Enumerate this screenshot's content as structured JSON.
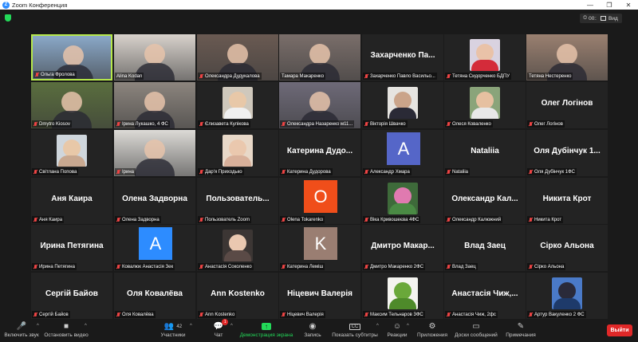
{
  "window": {
    "title": "Zoom Конференция",
    "logo": "Z",
    "minimize": "—",
    "maximize": "❐",
    "close": "✕"
  },
  "header": {
    "timer": "00:18:54",
    "timer_icon": "⏲",
    "view_label": "Вид"
  },
  "colors": {
    "active_border": "#b6e84b",
    "leave": "#e02828",
    "security": "#23d959"
  },
  "tiles": [
    {
      "caption": "Ольга Фролова",
      "kind": "video",
      "muted": true,
      "bg": "#8aa8c8",
      "active": true
    },
    {
      "caption": "Alina Kodan",
      "kind": "video",
      "muted": false,
      "bg": "#d8d2cc"
    },
    {
      "caption": "Олександра Дудукалова",
      "kind": "video",
      "muted": true,
      "bg": "#6a5a52"
    },
    {
      "caption": "Тамара Макаренко",
      "kind": "video",
      "muted": false,
      "bg": "#7a6e6a"
    },
    {
      "caption": "Захарченко Павло Васильо...",
      "kind": "name",
      "name": "Захарченко Па...",
      "muted": true
    },
    {
      "caption": "Тетяна Сидорченко БДПУ",
      "kind": "photo",
      "muted": true,
      "ph_bg": "#d9d2e0",
      "ph_head": "#e9c2a8",
      "ph_body": "#d42b3a"
    },
    {
      "caption": "Тетяна Нестеренко",
      "kind": "video",
      "muted": false,
      "bg": "#9a8070"
    },
    {
      "caption": "Dmytro Kiosov",
      "kind": "video",
      "muted": true,
      "bg": "#5a6e3e"
    },
    {
      "caption": "Ірина Лукашко, 4 ФС",
      "kind": "video",
      "muted": true,
      "bg": "#8c857e"
    },
    {
      "caption": "Єлизавета Кулікова",
      "kind": "photo",
      "muted": true,
      "ph_bg": "#cfc8bc",
      "ph_head": "#e8c8a8",
      "ph_body": "#f0f0f0"
    },
    {
      "caption": "Олександра Назаренко м11...",
      "kind": "video",
      "muted": true,
      "bg": "#6e6a78"
    },
    {
      "caption": "Вікторія Швачко",
      "kind": "photo",
      "muted": true,
      "ph_bg": "#e6e4e0",
      "ph_head": "#caa48a",
      "ph_body": "#2a2a36"
    },
    {
      "caption": "Олеся Коваленко",
      "kind": "photo",
      "muted": true,
      "ph_bg": "#8aa47a",
      "ph_head": "#e6c0a0",
      "ph_body": "#e8e8e8"
    },
    {
      "caption": "Олег Логінов",
      "kind": "name",
      "name": "Олег Логінов",
      "muted": true
    },
    {
      "caption": "Світлана Попова",
      "kind": "photo",
      "muted": true,
      "ph_bg": "#cfd6dc",
      "ph_head": "#e8c8a8",
      "ph_body": "#c8a890"
    },
    {
      "caption": "Ірина",
      "kind": "video",
      "muted": true,
      "bg": "#dcdad6"
    },
    {
      "caption": "Дар'я Приходько",
      "kind": "photo",
      "muted": true,
      "ph_bg": "#e8d8c8",
      "ph_head": "#eac8ae",
      "ph_body": "#d8b09a"
    },
    {
      "caption": "Катерина Дудорова",
      "kind": "name",
      "name": "Катерина Дудо...",
      "muted": true
    },
    {
      "caption": "Александр Хмара",
      "kind": "avatar",
      "letter": "A",
      "color": "#5566c8",
      "muted": true
    },
    {
      "caption": "Nataliia",
      "kind": "name",
      "name": "Nataliia",
      "muted": true
    },
    {
      "caption": "Оля Дубінчук 1ФС",
      "kind": "name",
      "name": "Оля Дубінчук 1...",
      "muted": true
    },
    {
      "caption": "Аня Каира",
      "kind": "name",
      "name": "Аня Каира",
      "muted": true
    },
    {
      "caption": "Олена Задворна",
      "kind": "name",
      "name": "Олена Задворна",
      "muted": true
    },
    {
      "caption": "Пользователь Zoom",
      "kind": "name",
      "name": "Пользователь...",
      "muted": true
    },
    {
      "caption": "Olena Tokarenko",
      "kind": "avatar",
      "letter": "O",
      "color": "#f04e1a",
      "muted": true
    },
    {
      "caption": "Віка Кривошеєва 4ФС",
      "kind": "photo",
      "muted": true,
      "ph_bg": "#3e6a3a",
      "ph_head": "#e07ab0",
      "ph_body": "#4a8a44"
    },
    {
      "caption": "Олександр Калюжний",
      "kind": "name",
      "name": "Олександр Кал...",
      "muted": true
    },
    {
      "caption": "Никита Крот",
      "kind": "name",
      "name": "Никита Крот",
      "muted": true
    },
    {
      "caption": "Ирина Петягина",
      "kind": "name",
      "name": "Ирина Петягина",
      "muted": true
    },
    {
      "caption": "Ковалюк Анастасія Зек",
      "kind": "avatar",
      "letter": "A",
      "color": "#2d8cff",
      "muted": true
    },
    {
      "caption": "Анастасія Соколенко",
      "kind": "photo",
      "muted": true,
      "ph_bg": "#3c3634",
      "ph_head": "#eac8b0",
      "ph_body": "#5a4a46"
    },
    {
      "caption": "Катерина Леміш",
      "kind": "avatar",
      "letter": "K",
      "color": "#9a7e72",
      "muted": true
    },
    {
      "caption": "Дмитро Макаренко 2ФС",
      "kind": "name",
      "name": "Дмитро Макар...",
      "muted": true
    },
    {
      "caption": "Влад Заец",
      "kind": "name",
      "name": "Влад Заец",
      "muted": true
    },
    {
      "caption": "Сірко Альона",
      "kind": "name",
      "name": "Сірко Альона",
      "muted": true
    },
    {
      "caption": "Сергій Байов",
      "kind": "name",
      "name": "Сергій Байов",
      "muted": true
    },
    {
      "caption": "Оля Ковалёва",
      "kind": "name",
      "name": "Оля Ковалёва",
      "muted": true
    },
    {
      "caption": "Ann Kostenko",
      "kind": "name",
      "name": "Ann Kostenko",
      "muted": true
    },
    {
      "caption": "Ніцевич Валерія",
      "kind": "name",
      "name": "Ніцевич Валерія",
      "muted": true
    },
    {
      "caption": "Максим Тельнаров 3ФС",
      "kind": "photo",
      "muted": true,
      "ph_bg": "#f4f4f0",
      "ph_head": "#6aa83a",
      "ph_body": "#4e8a2a"
    },
    {
      "caption": "Анастасія Чиж, 2фс",
      "kind": "name",
      "name": "Анастасія Чиж,...",
      "muted": true
    },
    {
      "caption": "Артур Вакуленко 2 ФС",
      "kind": "photo",
      "muted": true,
      "ph_bg": "#4a7ac8",
      "ph_head": "#2a2a3a",
      "ph_body": "#1e3a6a"
    }
  ],
  "toolbar": {
    "mic": {
      "icon": "🎤",
      "label": "Включить звук"
    },
    "video": {
      "icon": "■",
      "label": "Остановить видео"
    },
    "participants": {
      "icon": "👥",
      "label": "Участники",
      "count": "42"
    },
    "chat": {
      "icon": "💬",
      "label": "Чат",
      "badge": "1"
    },
    "share": {
      "icon": "↑",
      "label": "Демонстрация экрана"
    },
    "record": {
      "icon": "◉",
      "label": "Запись"
    },
    "captions": {
      "icon": "CC",
      "label": "Показать субтитры"
    },
    "reactions": {
      "icon": "☺",
      "label": "Реакции"
    },
    "apps": {
      "icon": "⚙",
      "label": "Приложения"
    },
    "whiteboard": {
      "icon": "▭",
      "label": "Доски сообщений"
    },
    "notes": {
      "icon": "✎",
      "label": "Примечания"
    },
    "caret": "^",
    "leave": "Выйти"
  }
}
